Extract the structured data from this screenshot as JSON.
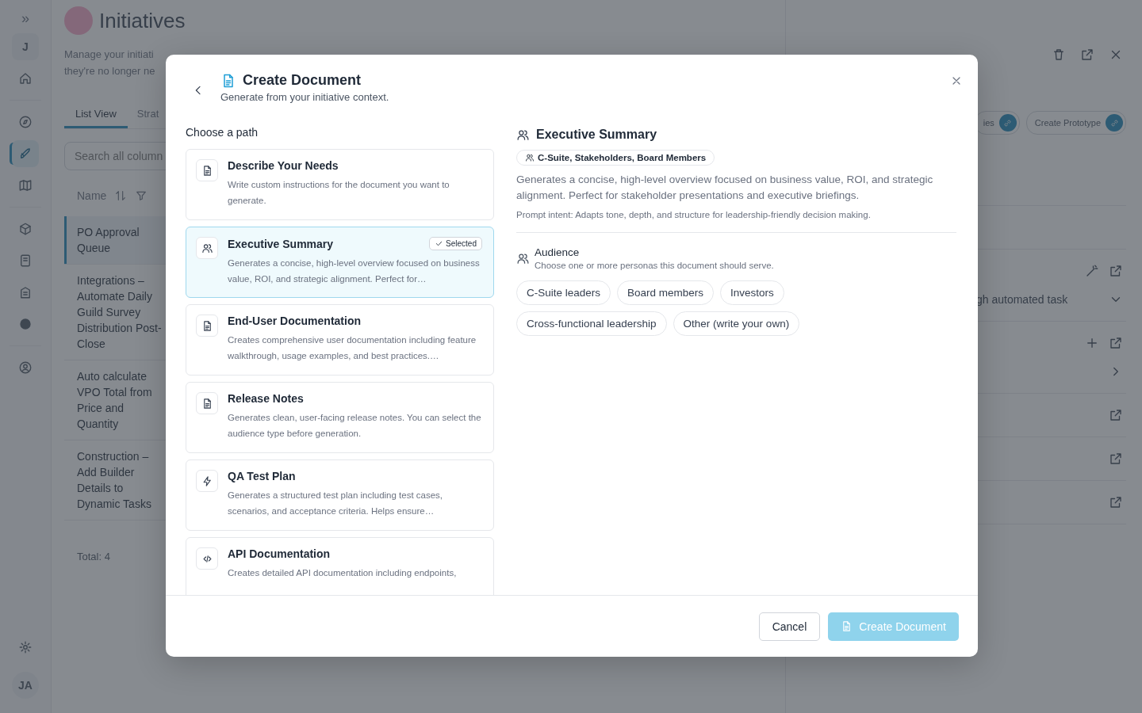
{
  "sidebar": {
    "expand": "»",
    "user_initial": "J",
    "items": [
      {
        "selected": false
      },
      {
        "selected": false
      },
      {
        "selected": true
      },
      {
        "selected": false
      },
      {
        "selected": false
      },
      {
        "selected": false
      },
      {
        "selected": false
      },
      {
        "selected": false
      },
      {
        "selected": false
      }
    ],
    "avatar": "JA"
  },
  "page": {
    "title": "Initiatives",
    "description": [
      "Manage your initiati",
      "they're no longer ne"
    ],
    "tabs": [
      {
        "label": "List View",
        "selected": true
      },
      {
        "label": "Strat",
        "selected": false
      }
    ],
    "search": {
      "placeholder": "Search all column"
    },
    "column": "Name",
    "rows": [
      {
        "name": "PO Approval Queue",
        "selected": true
      },
      {
        "name": "Integrations – Automate Daily Guild Survey Distribution Post-Close",
        "selected": false
      },
      {
        "name": "Auto calculate VPO Total from Price and Quantity",
        "selected": false
      },
      {
        "name": "Construction – Add Builder Details to Dynamic Tasks",
        "selected": false
      }
    ],
    "total": "Total: 4"
  },
  "detail": {
    "chips": [
      "ies",
      "Create Prototype"
    ],
    "task": "gh automated task"
  },
  "modal": {
    "title": "Create Document",
    "subtitle": "Generate from your initiative context.",
    "path_label": "Choose a path",
    "selected_badge": "Selected",
    "paths": [
      {
        "kind": "document",
        "title": "Describe Your Needs",
        "description": "Write custom instructions for the document you want to generate.",
        "selected": false
      },
      {
        "kind": "people",
        "title": "Executive Summary",
        "description": "Generates a concise, high-level overview focused on business value, ROI, and strategic alignment. Perfect for…",
        "selected": true
      },
      {
        "kind": "document",
        "title": "End-User Documentation",
        "description": "Creates comprehensive user documentation including feature walkthrough, usage examples, and best practices.…",
        "selected": false
      },
      {
        "kind": "document",
        "title": "Release Notes",
        "description": "Generates clean, user-facing release notes. You can select the audience type before generation.",
        "selected": false
      },
      {
        "kind": "bolt",
        "title": "QA Test Plan",
        "description": "Generates a structured test plan including test cases, scenarios, and acceptance criteria. Helps ensure…",
        "selected": false
      },
      {
        "kind": "code",
        "title": "API Documentation",
        "description": "Creates detailed API documentation including endpoints,",
        "selected": false
      }
    ],
    "detail": {
      "title": "Executive Summary",
      "audience_tag": "C-Suite, Stakeholders, Board Members",
      "description": "Generates a concise, high-level overview focused on business value, ROI, and strategic alignment. Perfect for stakeholder presentations and executive briefings.",
      "prompt_intent": "Prompt intent: Adapts tone, depth, and structure for leadership-friendly decision making.",
      "audience": {
        "title": "Audience",
        "hint": "Choose one or more personas this document should serve.",
        "options": [
          {
            "label": "C-Suite leaders",
            "selected": false
          },
          {
            "label": "Board members",
            "selected": false
          },
          {
            "label": "Investors",
            "selected": false
          },
          {
            "label": "Cross-functional leadership",
            "selected": false
          },
          {
            "label": "Other (write your own)",
            "selected": false
          }
        ]
      }
    },
    "cancel": "Cancel",
    "create": {
      "label": "Create Document",
      "disabled": true
    }
  }
}
